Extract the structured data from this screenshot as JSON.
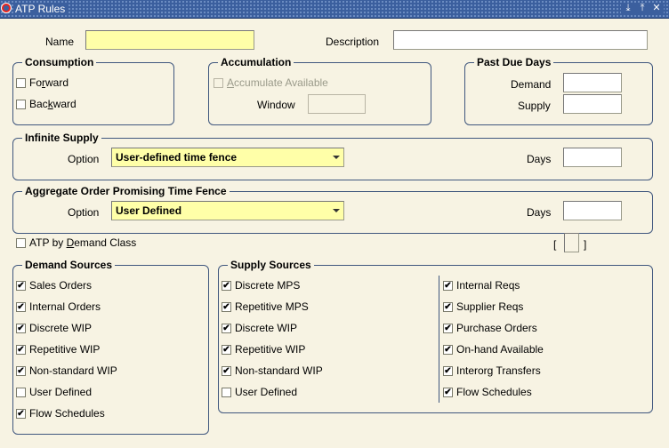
{
  "window": {
    "title": "ATP Rules",
    "controls": [
      "⤓",
      "⤒",
      "✕"
    ]
  },
  "header": {
    "name_label": "Name",
    "name_value": "",
    "description_label": "Description",
    "description_value": ""
  },
  "consumption": {
    "title": "Consumption",
    "forward": {
      "pre": "Fo",
      "accel": "r",
      "post": "ward",
      "checked": false
    },
    "backward": {
      "pre": "Bac",
      "accel": "k",
      "post": "ward",
      "checked": false
    }
  },
  "accumulation": {
    "title": "Accumulation",
    "accumulate_available": {
      "pre": "",
      "accel": "A",
      "post": "ccumulate Available",
      "checked": false,
      "enabled": false
    },
    "window_label": "Window",
    "window_value": ""
  },
  "past_due": {
    "title": "Past Due Days",
    "demand_label": "Demand",
    "demand_value": "",
    "supply_label": "Supply",
    "supply_value": ""
  },
  "infinite_supply": {
    "title": "Infinite Supply",
    "option_label": "Option",
    "option_value": "User-defined time fence",
    "days_label": "Days",
    "days_value": ""
  },
  "aggregate": {
    "title": "Aggregate Order Promising Time Fence",
    "option_label": "Option",
    "option_value": "User Defined",
    "days_label": "Days",
    "days_value": ""
  },
  "atp_by_demand_class": {
    "pre": "ATP by ",
    "accel": "D",
    "post": "emand Class",
    "checked": false
  },
  "bracket_left": "[",
  "bracket_right": "]",
  "demand_sources": {
    "title": "Demand Sources",
    "items": [
      {
        "label": "Sales Orders",
        "checked": true
      },
      {
        "label": "Internal Orders",
        "checked": true
      },
      {
        "label": "Discrete WIP",
        "checked": true
      },
      {
        "label": "Repetitive WIP",
        "checked": true
      },
      {
        "label": "Non-standard WIP",
        "checked": true
      },
      {
        "label": "User Defined",
        "checked": false
      },
      {
        "label": "Flow Schedules",
        "checked": true
      }
    ]
  },
  "supply_sources": {
    "title": "Supply Sources",
    "left_items": [
      {
        "label": "Discrete MPS",
        "checked": true
      },
      {
        "label": "Repetitive MPS",
        "checked": true
      },
      {
        "label": "Discrete WIP",
        "checked": true
      },
      {
        "label": "Repetitive WIP",
        "checked": true
      },
      {
        "label": "Non-standard WIP",
        "checked": true
      },
      {
        "label": "User Defined",
        "checked": false
      }
    ],
    "right_items": [
      {
        "label": "Internal Reqs",
        "checked": true
      },
      {
        "label": "Supplier Reqs",
        "checked": true
      },
      {
        "label": "Purchase Orders",
        "checked": true
      },
      {
        "label": "On-hand Available",
        "checked": true
      },
      {
        "label": "Interorg Transfers",
        "checked": true
      },
      {
        "label": "Flow Schedules",
        "checked": true
      }
    ]
  },
  "check_mark": "✔",
  "colors": {
    "titlebar": "#3b5f9e",
    "canvas": "#f7f3e3",
    "required_field": "#ffffa8",
    "group_border": "#40577e"
  }
}
